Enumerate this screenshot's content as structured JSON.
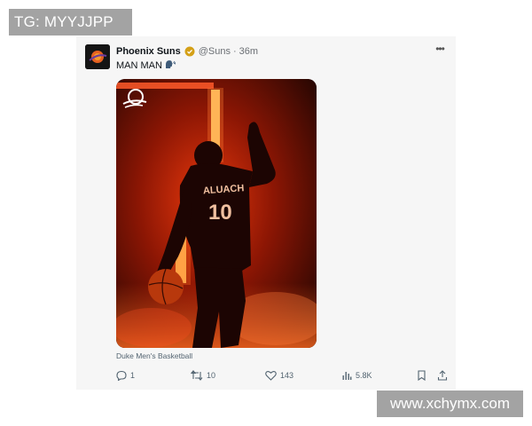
{
  "watermarks": {
    "top": "TG: MYYJJPP",
    "bottom": "www.xchymx.com"
  },
  "tweet": {
    "display_name": "Phoenix Suns",
    "handle": "@Suns",
    "separator": "·",
    "timestamp": "36m",
    "text": "MAN MAN",
    "text_emoji_icon": "speaking-head-icon",
    "media_caption": "Duke Men's Basketball",
    "jersey_name": "ALUACH",
    "jersey_number": "10",
    "actions": {
      "replies": "1",
      "retweets": "10",
      "likes": "143",
      "views": "5.8K"
    }
  },
  "colors": {
    "verified": "#d4a017",
    "glow": "#ff3b10",
    "background": "#f6f6f6"
  }
}
